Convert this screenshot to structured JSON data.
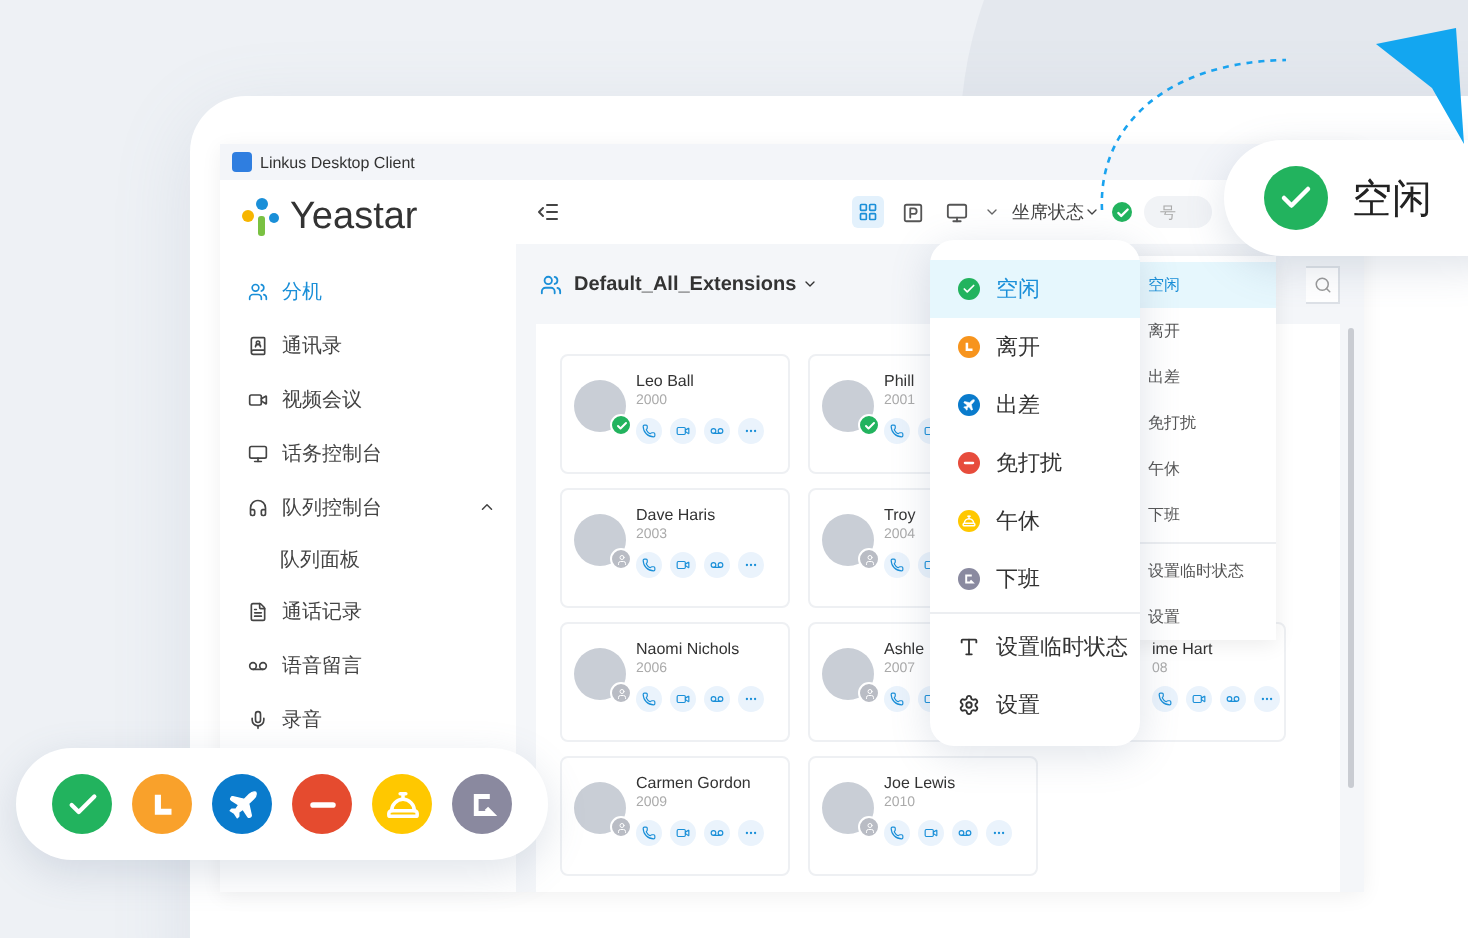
{
  "window": {
    "title": "Linkus Desktop Client"
  },
  "sidebar": {
    "logo": "Yeastar",
    "items": [
      {
        "label": "分机",
        "selected": true
      },
      {
        "label": "通讯录",
        "selected": false
      },
      {
        "label": "视频会议",
        "selected": false
      },
      {
        "label": "话务控制台",
        "selected": false
      },
      {
        "label": "队列控制台",
        "selected": false,
        "expanded": true,
        "children": [
          {
            "label": "队列面板",
            "selected": false
          }
        ]
      },
      {
        "label": "通话记录",
        "selected": false
      },
      {
        "label": "语音留言",
        "selected": false
      },
      {
        "label": "录音",
        "selected": false
      }
    ]
  },
  "toolbar": {
    "agent_status": "坐席状态",
    "search_placeholder": "号"
  },
  "group": {
    "name": "Default_All_Extensions"
  },
  "extension_rows": [
    [
      {
        "name": "Leo Ball",
        "number": "2000",
        "online": true
      },
      {
        "name": "Phill",
        "number": "2001",
        "online": true
      }
    ],
    [
      {
        "name": "Dave Haris",
        "number": "2003",
        "online": false
      },
      {
        "name": "Troy",
        "number": "2004",
        "online": false
      }
    ],
    [
      {
        "name": "Naomi Nichols",
        "number": "2006",
        "online": false
      },
      {
        "name": "Ashle",
        "number": "2007",
        "online": false
      },
      {
        "name": "ime Hart",
        "number": "08"
      }
    ],
    [
      {
        "name": "Carmen Gordon",
        "number": "2009",
        "online": false
      },
      {
        "name": "Joe Lewis",
        "number": "2010",
        "online": false
      }
    ]
  ],
  "status_menu": {
    "items": [
      {
        "label": "空闲",
        "kind": "available",
        "color": "#22b35e",
        "selected": true
      },
      {
        "label": "离开",
        "kind": "away",
        "color": "#f7941d",
        "selected": false
      },
      {
        "label": "出差",
        "kind": "trip",
        "color": "#0a7bcc",
        "selected": false
      },
      {
        "label": "免打扰",
        "kind": "dnd",
        "color": "#e74c3c",
        "selected": false
      },
      {
        "label": "午休",
        "kind": "lunch",
        "color": "#ffc800",
        "selected": false
      },
      {
        "label": "下班",
        "kind": "off",
        "color": "#8a8aa0",
        "selected": false
      }
    ],
    "actions": [
      {
        "label": "设置临时状态",
        "kind": "temp"
      },
      {
        "label": "设置",
        "kind": "settings"
      }
    ]
  },
  "back_menu": {
    "items": [
      {
        "label": "空闲",
        "selected": true
      },
      {
        "label": "离开",
        "selected": false
      },
      {
        "label": "出差",
        "selected": false
      },
      {
        "label": "免打扰",
        "selected": false
      },
      {
        "label": "午休",
        "selected": false
      },
      {
        "label": "下班",
        "selected": false
      }
    ],
    "actions": [
      {
        "label": "设置临时状态"
      },
      {
        "label": "设置"
      }
    ]
  },
  "status_bubble": {
    "label": "空闲",
    "kind": "available",
    "color": "#22b35e"
  },
  "status_legend": [
    {
      "kind": "available",
      "color": "#22b35e"
    },
    {
      "kind": "away",
      "color": "#f9a12b"
    },
    {
      "kind": "trip",
      "color": "#0a7bcc"
    },
    {
      "kind": "dnd",
      "color": "#e54b2f"
    },
    {
      "kind": "lunch",
      "color": "#ffc800"
    },
    {
      "kind": "off",
      "color": "#8a899f"
    }
  ]
}
